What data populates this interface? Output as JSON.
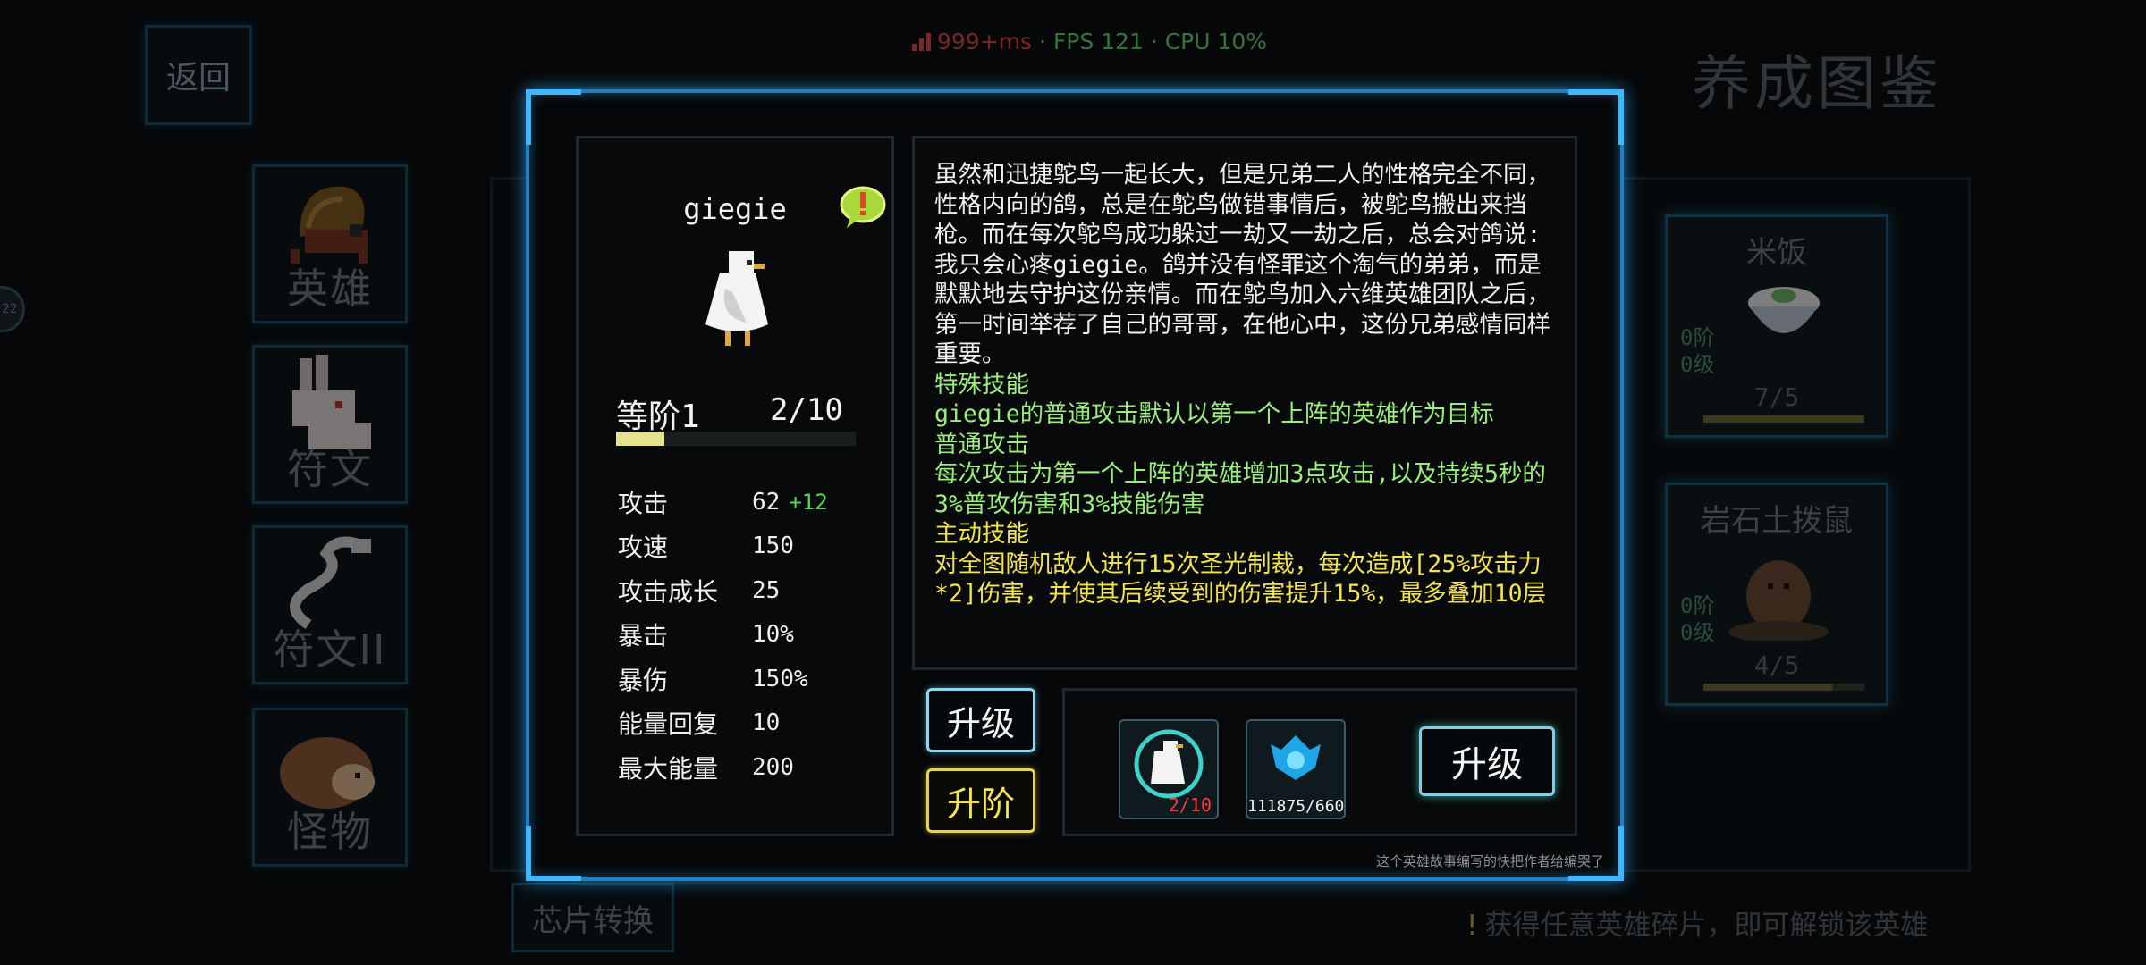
{
  "status": {
    "latency": "999+ms",
    "fps_cpu": " · FPS 121 · CPU 10%",
    "latency_color": "#e2463f",
    "fps_color": "#5fd26b"
  },
  "header": {
    "back_label": "返回",
    "title": "养成图鉴"
  },
  "sidebar": {
    "tabs": [
      {
        "label": "英雄",
        "icon": "hermit-crab-icon"
      },
      {
        "label": "符文",
        "icon": "rabbit-icon"
      },
      {
        "label": "符文II",
        "icon": "cobra-icon"
      },
      {
        "label": "怪物",
        "icon": "hedgehog-icon"
      }
    ],
    "chip_button": "芯片转换",
    "side_badge": "22"
  },
  "background_cards": [
    {
      "name": "米饭",
      "rank": "0阶",
      "level": "0级",
      "count": "7/5",
      "progress": 1.0
    },
    {
      "name": "岩石土拨鼠",
      "rank": "0阶",
      "level": "0级",
      "count": "4/5",
      "progress": 0.8
    }
  ],
  "hint": {
    "icon": "exclamation-icon",
    "text": "获得任意英雄碎片，即可解锁该英雄"
  },
  "hero": {
    "name": "giegie",
    "rank_label": "等阶1",
    "rank_progress": "2/10",
    "rank_fraction": 0.2,
    "stats": [
      {
        "key": "攻击",
        "value": "62",
        "bonus": "+12"
      },
      {
        "key": "攻速",
        "value": "150",
        "bonus": ""
      },
      {
        "key": "攻击成长",
        "value": "25",
        "bonus": ""
      },
      {
        "key": "暴击",
        "value": "10%",
        "bonus": ""
      },
      {
        "key": "暴伤",
        "value": "150%",
        "bonus": ""
      },
      {
        "key": "能量回复",
        "value": "10",
        "bonus": ""
      },
      {
        "key": "最大能量",
        "value": "200",
        "bonus": ""
      }
    ]
  },
  "story": {
    "lore": "虽然和迅捷鸵鸟一起长大，但是兄弟二人的性格完全不同，性格内向的鸽，总是在鸵鸟做错事情后，被鸵鸟搬出来挡枪。而在每次鸵鸟成功躲过一劫又一劫之后，总会对鸽说:我只会心疼giegie。鸽并没有怪罪这个淘气的弟弟，而是默默地去守护这份亲情。而在鸵鸟加入六维英雄团队之后，第一时间举荐了自己的哥哥，在他心中，这份兄弟感情同样重要。",
    "special_title": "特殊技能",
    "special_text": "giegie的普通攻击默认以第一个上阵的英雄作为目标",
    "normal_title": "普通攻击",
    "normal_text": "每次攻击为第一个上阵的英雄增加3点攻击,以及持续5秒的3%普攻伤害和3%技能伤害",
    "active_title": "主动技能",
    "active_text": "对全图随机敌人进行15次圣光制裁，每次造成[25%攻击力*2]伤害，并使其后续受到的伤害提升15%，最多叠加10层"
  },
  "buttons": {
    "upgrade": "升级",
    "rank_up": "升阶",
    "upgrade2": "升级"
  },
  "costs": [
    {
      "icon": "pigeon-shard-icon",
      "amount": "2/10",
      "color": "#ff3b3b"
    },
    {
      "icon": "crystal-icon",
      "amount": "111875/660",
      "color": "#f2f2f2"
    }
  ],
  "footnote": "这个英雄故事编写的快把作者给编哭了"
}
